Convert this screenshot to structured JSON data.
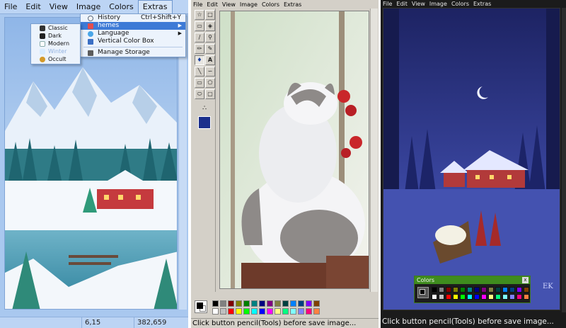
{
  "winter_window": {
    "menu": [
      "File",
      "Edit",
      "View",
      "Image",
      "Colors",
      "Extras"
    ],
    "active_menu": "Extras",
    "extras_menu": {
      "items": [
        {
          "label": "History",
          "shortcut": "Ctrl+Shift+Y",
          "icon": "history-icon"
        },
        {
          "label": "hemes",
          "icon": "themes-icon",
          "submenu": true
        },
        {
          "label": "Language",
          "icon": "language-icon",
          "submenu": true
        },
        {
          "label": "Vertical Color Box",
          "icon": "color-box-icon"
        },
        {
          "label": "Manage Storage",
          "icon": "storage-icon"
        }
      ]
    },
    "themes_submenu": [
      {
        "label": "Classic",
        "icon_color": "#333333"
      },
      {
        "label": "Dark",
        "icon_color": "#222222"
      },
      {
        "label": "Modern",
        "icon_color": "#ffffff"
      },
      {
        "label": "Winter",
        "icon_color": "#d8ecff",
        "dimmed": true
      },
      {
        "label": "Occult",
        "icon_color": "#d49a2a"
      }
    ],
    "status": {
      "coords": "6,15",
      "size": "382,659"
    },
    "colors": {
      "menubar": "#bcd4f4",
      "highlight": "#3d7ad6",
      "frame": "#a9c8ef"
    }
  },
  "classic_window": {
    "menu": [
      "File",
      "Edit",
      "View",
      "Image",
      "Colors",
      "Extras"
    ],
    "tools": [
      "free-select-icon",
      "rect-select-icon",
      "eraser-icon",
      "fill-icon",
      "eyedropper-icon",
      "magnifier-icon",
      "pencil-icon",
      "brush-icon",
      "airbrush-icon",
      "text-icon",
      "line-icon",
      "curve-icon",
      "rectangle-icon",
      "polygon-icon",
      "ellipse-icon",
      "rounded-rect-icon"
    ],
    "active_tool": "airbrush-icon",
    "status": "Click button pencil(Tools) before save image...",
    "palette": [
      "#000000",
      "#808080",
      "#800000",
      "#808000",
      "#008000",
      "#008080",
      "#000080",
      "#800080",
      "#808040",
      "#004040",
      "#0080ff",
      "#004080",
      "#8000ff",
      "#804000",
      "#ffffff",
      "#c0c0c0",
      "#ff0000",
      "#ffff00",
      "#00ff00",
      "#00ffff",
      "#0000ff",
      "#ff00ff",
      "#ffff80",
      "#00ff80",
      "#80ffff",
      "#8080ff",
      "#ff0080",
      "#ff8040"
    ]
  },
  "dark_window": {
    "menu": [
      "File",
      "Edit",
      "View",
      "Image",
      "Colors",
      "Extras"
    ],
    "status": "Click button pencil(Tools) before save image...",
    "colors_box": {
      "title": "Colors",
      "close": "x",
      "palette": [
        "#000000",
        "#808080",
        "#800000",
        "#808000",
        "#008000",
        "#008080",
        "#000080",
        "#800080",
        "#808040",
        "#004040",
        "#0080ff",
        "#004080",
        "#8000ff",
        "#804000",
        "#ffffff",
        "#c0c0c0",
        "#ff0000",
        "#ffff00",
        "#00ff00",
        "#00ffff",
        "#0000ff",
        "#ff00ff",
        "#ffff80",
        "#00ff80",
        "#80ffff",
        "#8080ff",
        "#ff0080",
        "#ff8040"
      ]
    },
    "signature": "EK"
  }
}
